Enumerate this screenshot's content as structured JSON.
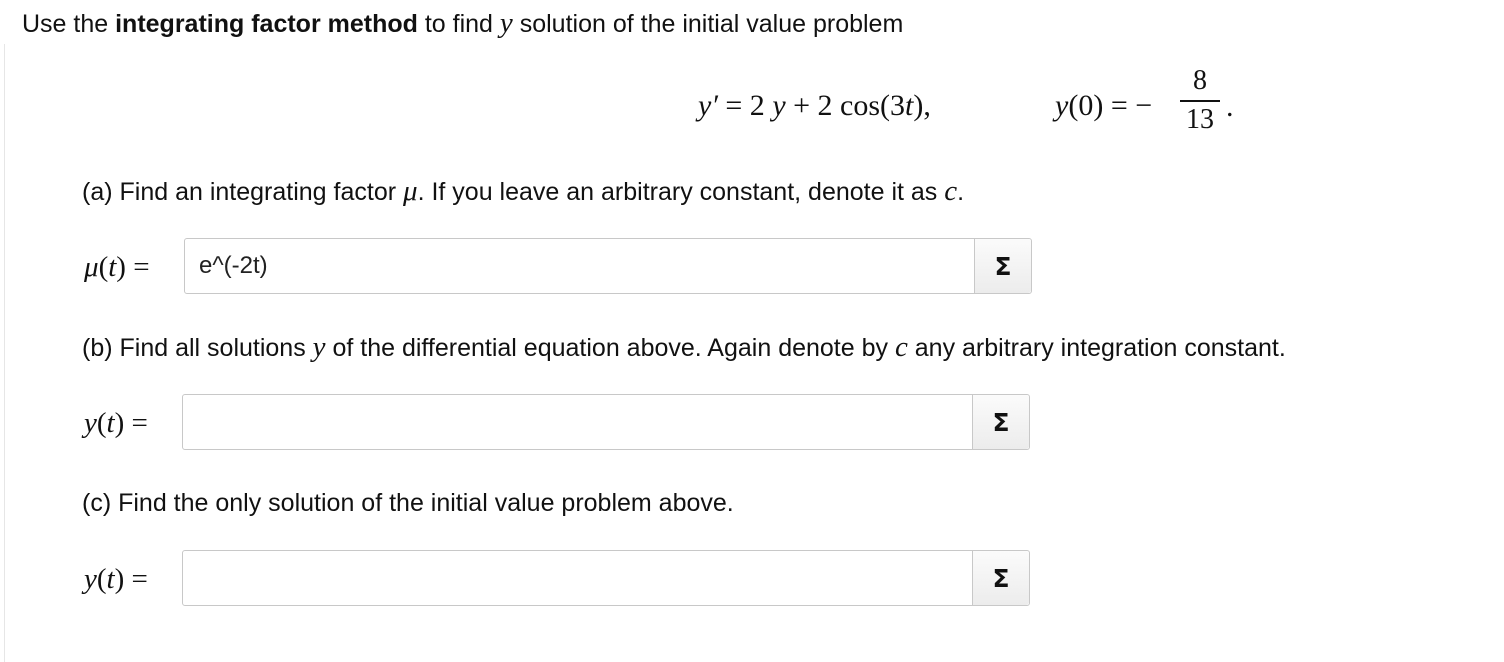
{
  "intro": {
    "prefix": "Use the ",
    "bold": "integrating factor method",
    "middle": " to find ",
    "var": "y",
    "suffix": " solution of the initial value problem"
  },
  "equation": {
    "lhs": "y′",
    "eq": " = 2 ",
    "y": "y",
    "rest": " + 2 cos(3",
    "t": "t",
    "close": "),"
  },
  "initial_condition": {
    "lhs": "y",
    "arg": "(0)",
    "eq": " = −",
    "numerator": "8",
    "denominator": "13",
    "dot": "."
  },
  "part_a": {
    "text_before": "(a) Find an integrating factor ",
    "symbol": "μ",
    "text_after": ". If you leave an arbitrary constant, denote it as ",
    "constant": "c",
    "end": ".",
    "label_fn": "μ",
    "label_arg": "(",
    "label_t": "t",
    "label_close": ") =",
    "input_value": "e^(-2t)",
    "sigma": "Σ"
  },
  "part_b": {
    "text_before": "(b) Find all solutions ",
    "symbol": "y",
    "text_middle": " of the differential equation above. Again denote by ",
    "constant": "c",
    "text_after": " any arbitrary integration constant.",
    "label_fn": "y",
    "label_arg": "(",
    "label_t": "t",
    "label_close": ") =",
    "input_value": "",
    "sigma": "Σ"
  },
  "part_c": {
    "text": "(c) Find the only solution of the initial value problem above.",
    "label_fn": "y",
    "label_arg": "(",
    "label_t": "t",
    "label_close": ") =",
    "input_value": "",
    "sigma": "Σ"
  }
}
